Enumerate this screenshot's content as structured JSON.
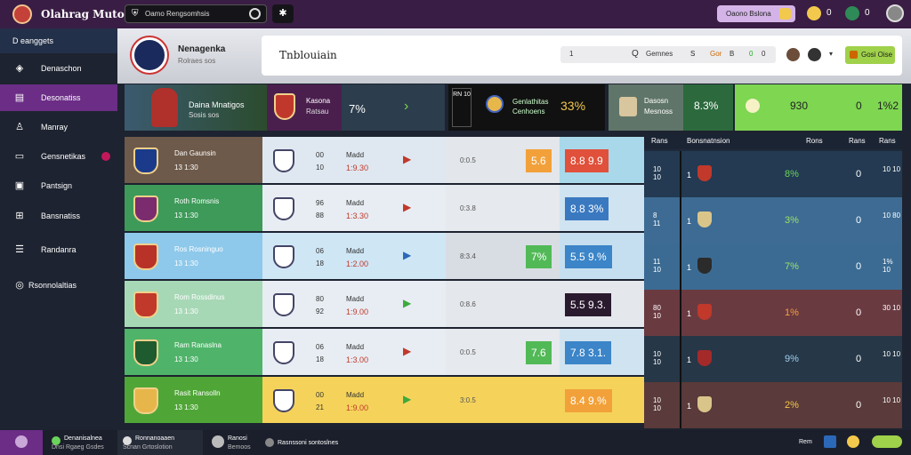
{
  "topbar": {
    "brand": "Olahrag Mutor",
    "search_icon": "shield-icon",
    "search_text": "Oamo Rengsomhsis",
    "settings_icon": "settings-icon",
    "cta_label": "Oaono Bslona",
    "stat1_value": "0",
    "stat2_value": "0"
  },
  "sidebar": {
    "header": "D eanggets",
    "items": [
      {
        "label": "Denaschon",
        "icon": "crest-icon"
      },
      {
        "label": "Desonatiss",
        "icon": "chart-icon"
      },
      {
        "label": "Manray",
        "icon": "person-icon"
      },
      {
        "label": "Gensnetikas",
        "icon": "car-icon"
      },
      {
        "label": "Pantsign",
        "icon": "image-icon"
      },
      {
        "label": "Bansnatiss",
        "icon": "frame-icon"
      },
      {
        "label": "Randanra",
        "icon": "list-icon"
      },
      {
        "label": "Rsonnolaltias",
        "icon": "circle-icon"
      }
    ]
  },
  "header": {
    "title": "Nenagenka",
    "subtitle": "Rolraes sos",
    "panel_title": "Tnblouiain",
    "search": {
      "a": "1",
      "b": "Q",
      "c": "Gemnes",
      "d": "S",
      "e": "Gor",
      "f": "B",
      "g": "0",
      "h": "0"
    },
    "chevron": "▾",
    "green_label": "Gosi Oise"
  },
  "featured": {
    "f1_title": "Daina Mnatigos",
    "f1_sub": "Sosis sos",
    "f2_title": "Kasona",
    "f2_sub": "Ratsau",
    "f3_value": "7%",
    "f4_mini": "RN 10",
    "f4_title": "Genlathitas",
    "f4_sub": "Cenhoens",
    "f4_value": "33%",
    "f5_title": "Dasosn",
    "f5_sub": "Mesnoss",
    "f6_value": "8.3%",
    "f7_v1": "930",
    "f7_v2": "0",
    "f7_v3": "1%2"
  },
  "rows": [
    {
      "name": "Dan Gaunsin",
      "sub": "13 1:30",
      "a": "00",
      "b": "10",
      "c": "Madd",
      "d": "1:9.30",
      "odds": "0:0.5",
      "box1": "5.6",
      "box2": "8.8 9.9",
      "team_bg": "#6e5a4a",
      "crest_bg": "#1b3b8a",
      "arrow_color": "#c0392b",
      "box1_color": "#f2a13a",
      "box2_color": "#e0503a",
      "info_bg": "#dfe8f1",
      "odds_bg": "#e3e6ea",
      "box_bg": "#a9d8ea"
    },
    {
      "name": "Roth Romsnis",
      "sub": "13 1:30",
      "a": "96",
      "b": "88",
      "c": "Madd",
      "d": "1:3.30",
      "odds": "0:3.8",
      "box1": "",
      "box2": "8.8 3%",
      "team_bg": "#3d9a59",
      "crest_bg": "#7a2c6e",
      "arrow_color": "#c0392b",
      "box1_color": "#8e44ad",
      "box2_color": "#3a79c0",
      "info_bg": "#e7edf3",
      "odds_bg": "#e6e9ed",
      "box_bg": "#d0e3f1"
    },
    {
      "name": "Ros Rosninguo",
      "sub": "13 1:30",
      "a": "06",
      "b": "18",
      "c": "Madd",
      "d": "1:2.00",
      "odds": "8:3.4",
      "box1": "7%",
      "box2": "5.5 9.%",
      "team_bg": "#8ec9eb",
      "crest_bg": "#b83228",
      "arrow_color": "#2b68b8",
      "box1_color": "#52b957",
      "box2_color": "#3b85c8",
      "info_bg": "#cfe6f5",
      "odds_bg": "#d8dde3",
      "box_bg": "#c5dff0"
    },
    {
      "name": "Rom Rossdinus",
      "sub": "13 1:30",
      "a": "80",
      "b": "92",
      "c": "Madd",
      "d": "1:9.00",
      "odds": "0:8.6",
      "box1": "",
      "box2": "5.5 9.3.",
      "team_bg": "#a7d8b6",
      "crest_bg": "#c0392b",
      "arrow_color": "#3daa3d",
      "box1_color": "#2a1a2e",
      "box2_color": "#2a1a2e",
      "info_bg": "#e7edf3",
      "odds_bg": "#e4e7eb",
      "box_bg": "#e4e7eb"
    },
    {
      "name": "Ram Ranaslna",
      "sub": "13 1:30",
      "a": "06",
      "b": "18",
      "c": "Madd",
      "d": "1:3.00",
      "odds": "0:0.5",
      "box1": "7.6",
      "box2": "7.8 3.1.",
      "team_bg": "#4fb46a",
      "crest_bg": "#1e5b2e",
      "arrow_color": "#c0392b",
      "box1_color": "#52b957",
      "box2_color": "#3b85c8",
      "info_bg": "#e7edf3",
      "odds_bg": "#e6e9ed",
      "box_bg": "#d0e3f1"
    },
    {
      "name": "Rasit Ransolln",
      "sub": "13 1:30",
      "a": "00",
      "b": "21",
      "c": "Madd",
      "d": "1:9.00",
      "odds": "3:0.5",
      "box1": "",
      "box2": "8.4 9.%",
      "team_bg": "#4fa636",
      "crest_bg": "#e7b64b",
      "arrow_color": "#3daa3d",
      "box1_color": "#e64980",
      "box2_color": "#f2a13a",
      "info_bg": "#f5d35b",
      "odds_bg": "#f5d35b",
      "box_bg": "#f5d35b"
    }
  ],
  "ranks": {
    "head": {
      "h1": "Rans",
      "h2": "Bonsnatnsion",
      "h3": "Rons",
      "h4": "Rans",
      "h5": "Rans"
    },
    "rows": [
      {
        "r1": "10 10",
        "n": "1",
        "pct": "8%",
        "z": "0",
        "r2": "10 10",
        "bg": "#233a52",
        "pct_color": "#6bd35b",
        "crest_bg": "#c0392b"
      },
      {
        "r1": "8 11",
        "n": "1",
        "pct": "3%",
        "z": "0",
        "r2": "10 80",
        "bg": "#3d6b93",
        "pct_color": "#9be36b",
        "crest_bg": "#d9c58a"
      },
      {
        "r1": "11 10",
        "n": "1",
        "pct": "7%",
        "z": "0",
        "r2": "1% 10",
        "bg": "#3b6b93",
        "pct_color": "#9be36b",
        "crest_bg": "#2b2b2b"
      },
      {
        "r1": "80 10",
        "n": "1",
        "pct": "1%",
        "z": "0",
        "r2": "30 10",
        "bg": "#6a3a41",
        "pct_color": "#f2a13a",
        "crest_bg": "#c0392b"
      },
      {
        "r1": "10 10",
        "n": "1",
        "pct": "9%",
        "z": "0",
        "r2": "10 10",
        "bg": "#263747",
        "pct_color": "#9fd0f0",
        "crest_bg": "#a42a2a"
      },
      {
        "r1": "10 10",
        "n": "1",
        "pct": "2%",
        "z": "0",
        "r2": "10 10",
        "bg": "#5a3a3a",
        "pct_color": "#f2c94c",
        "crest_bg": "#d9c58a"
      }
    ]
  },
  "bottom": {
    "b1": "Denanisalnea",
    "b1s": "Dnsi Rgaeg Gsdes",
    "b2": "Ronnanoaaen",
    "b2s": "Scnan Grtoslotion",
    "b3": "Ranosi",
    "b3s": "Bemoos",
    "b4": "Rasnssoni sontoslnes",
    "b5": "Rem",
    "colors": {
      "purple": "#6b2d86",
      "green": "#9fd14a",
      "gold": "#f2c94c"
    }
  }
}
